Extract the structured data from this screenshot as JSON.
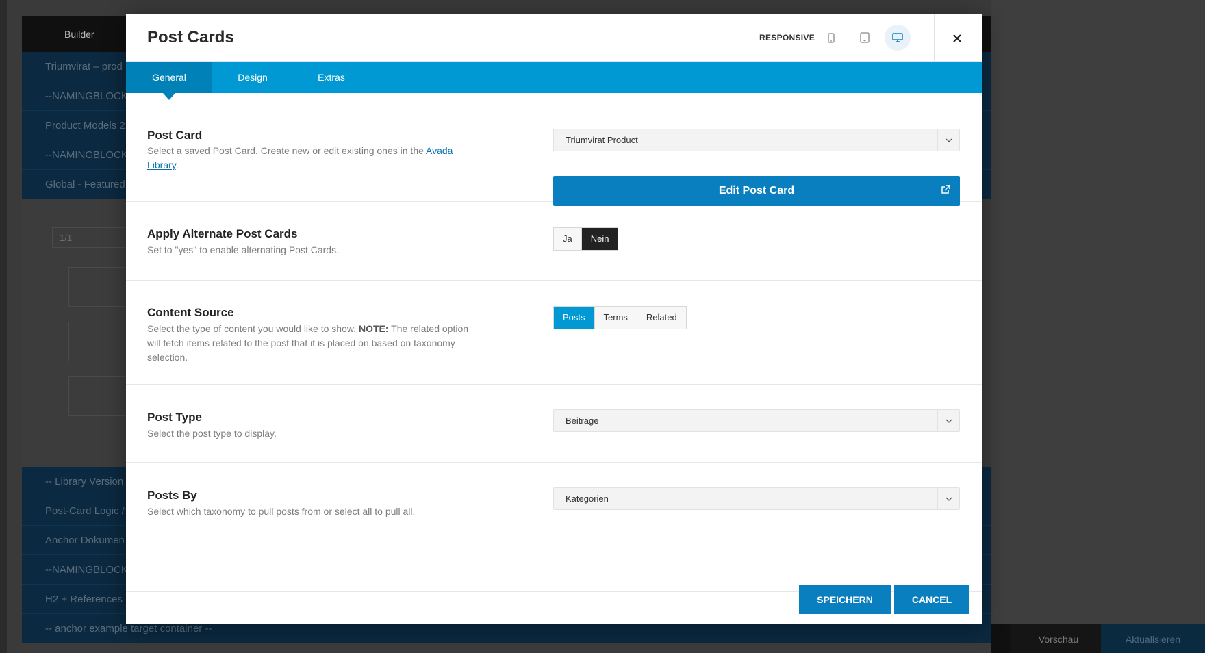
{
  "background": {
    "builder_tab": "Builder",
    "rows": [
      "Triumvirat – prod",
      "--NAMINGBLOCK-",
      "Product Models 2",
      "--NAMINGBLOCK-",
      "Global - Featured"
    ],
    "column_toolbar": "1/1",
    "rows_lower": [
      "-- Library Version",
      "Post-Card Logic /",
      "Anchor Dokumen",
      "--NAMINGBLOCK-",
      "H2 + References +",
      "-- anchor example target container --"
    ],
    "preview_label": "Vorschau",
    "update_label": "Aktualisieren"
  },
  "modal": {
    "title": "Post Cards",
    "responsive_label": "RESPONSIVE",
    "tabs": [
      "General",
      "Design",
      "Extras"
    ],
    "active_tab": "General"
  },
  "options": {
    "post_card": {
      "label": "Post Card",
      "desc_before": "Select a saved Post Card. Create new or edit existing ones in the ",
      "desc_link": "Avada Library",
      "desc_after": ".",
      "selected": "Triumvirat Product",
      "edit_button": "Edit Post Card"
    },
    "alternate": {
      "label": "Apply Alternate Post Cards",
      "desc": "Set to \"yes\" to enable alternating Post Cards.",
      "choices": [
        "Ja",
        "Nein"
      ],
      "selected": "Nein"
    },
    "content_source": {
      "label": "Content Source",
      "desc_before": "Select the type of content you would like to show. ",
      "desc_note": "NOTE:",
      "desc_after": " The related option will fetch items related to the post that it is placed on based on taxonomy selection.",
      "choices": [
        "Posts",
        "Terms",
        "Related"
      ],
      "selected": "Posts"
    },
    "post_type": {
      "label": "Post Type",
      "desc": "Select the post type to display.",
      "selected": "Beiträge"
    },
    "posts_by": {
      "label": "Posts By",
      "desc": "Select which taxonomy to pull posts from or select all to pull all.",
      "selected": "Kategorien"
    }
  },
  "footer": {
    "save_label": "SPEICHERN",
    "cancel_label": "CANCEL"
  },
  "colors": {
    "accent": "#0099d3",
    "button_blue": "#0a7fc0",
    "active_tab": "#0082b8",
    "dark_toggle": "#222222"
  }
}
